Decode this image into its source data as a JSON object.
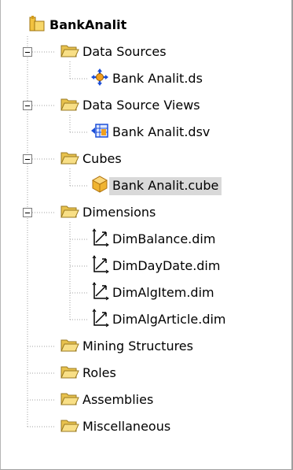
{
  "tree": {
    "root": {
      "label": "BankAnalit",
      "icon": "project-icon"
    },
    "folders": [
      {
        "label": "Data Sources",
        "expanded": true,
        "icon": "folder-open-icon",
        "children": [
          {
            "label": "Bank Analit.ds",
            "icon": "data-source-icon"
          }
        ]
      },
      {
        "label": "Data Source Views",
        "expanded": true,
        "icon": "folder-open-icon",
        "children": [
          {
            "label": "Bank Analit.dsv",
            "icon": "data-source-view-icon"
          }
        ]
      },
      {
        "label": "Cubes",
        "expanded": true,
        "icon": "folder-open-icon",
        "children": [
          {
            "label": "Bank Analit.cube",
            "icon": "cube-icon",
            "selected": true
          }
        ]
      },
      {
        "label": "Dimensions",
        "expanded": true,
        "icon": "folder-open-icon",
        "children": [
          {
            "label": "DimBalance.dim",
            "icon": "dimension-icon"
          },
          {
            "label": "DimDayDate.dim",
            "icon": "dimension-icon"
          },
          {
            "label": "DimAlgItem.dim",
            "icon": "dimension-icon"
          },
          {
            "label": "DimAlgArticle.dim",
            "icon": "dimension-icon"
          }
        ]
      },
      {
        "label": "Mining Structures",
        "icon": "folder-icon"
      },
      {
        "label": "Roles",
        "icon": "folder-icon"
      },
      {
        "label": "Assemblies",
        "icon": "folder-icon"
      },
      {
        "label": "Miscellaneous",
        "icon": "folder-icon"
      }
    ]
  },
  "colors": {
    "selection": "#d9d9d9",
    "folder": "#f5d56a",
    "cube": "#f0b430",
    "connector": "#a0a0a0"
  }
}
